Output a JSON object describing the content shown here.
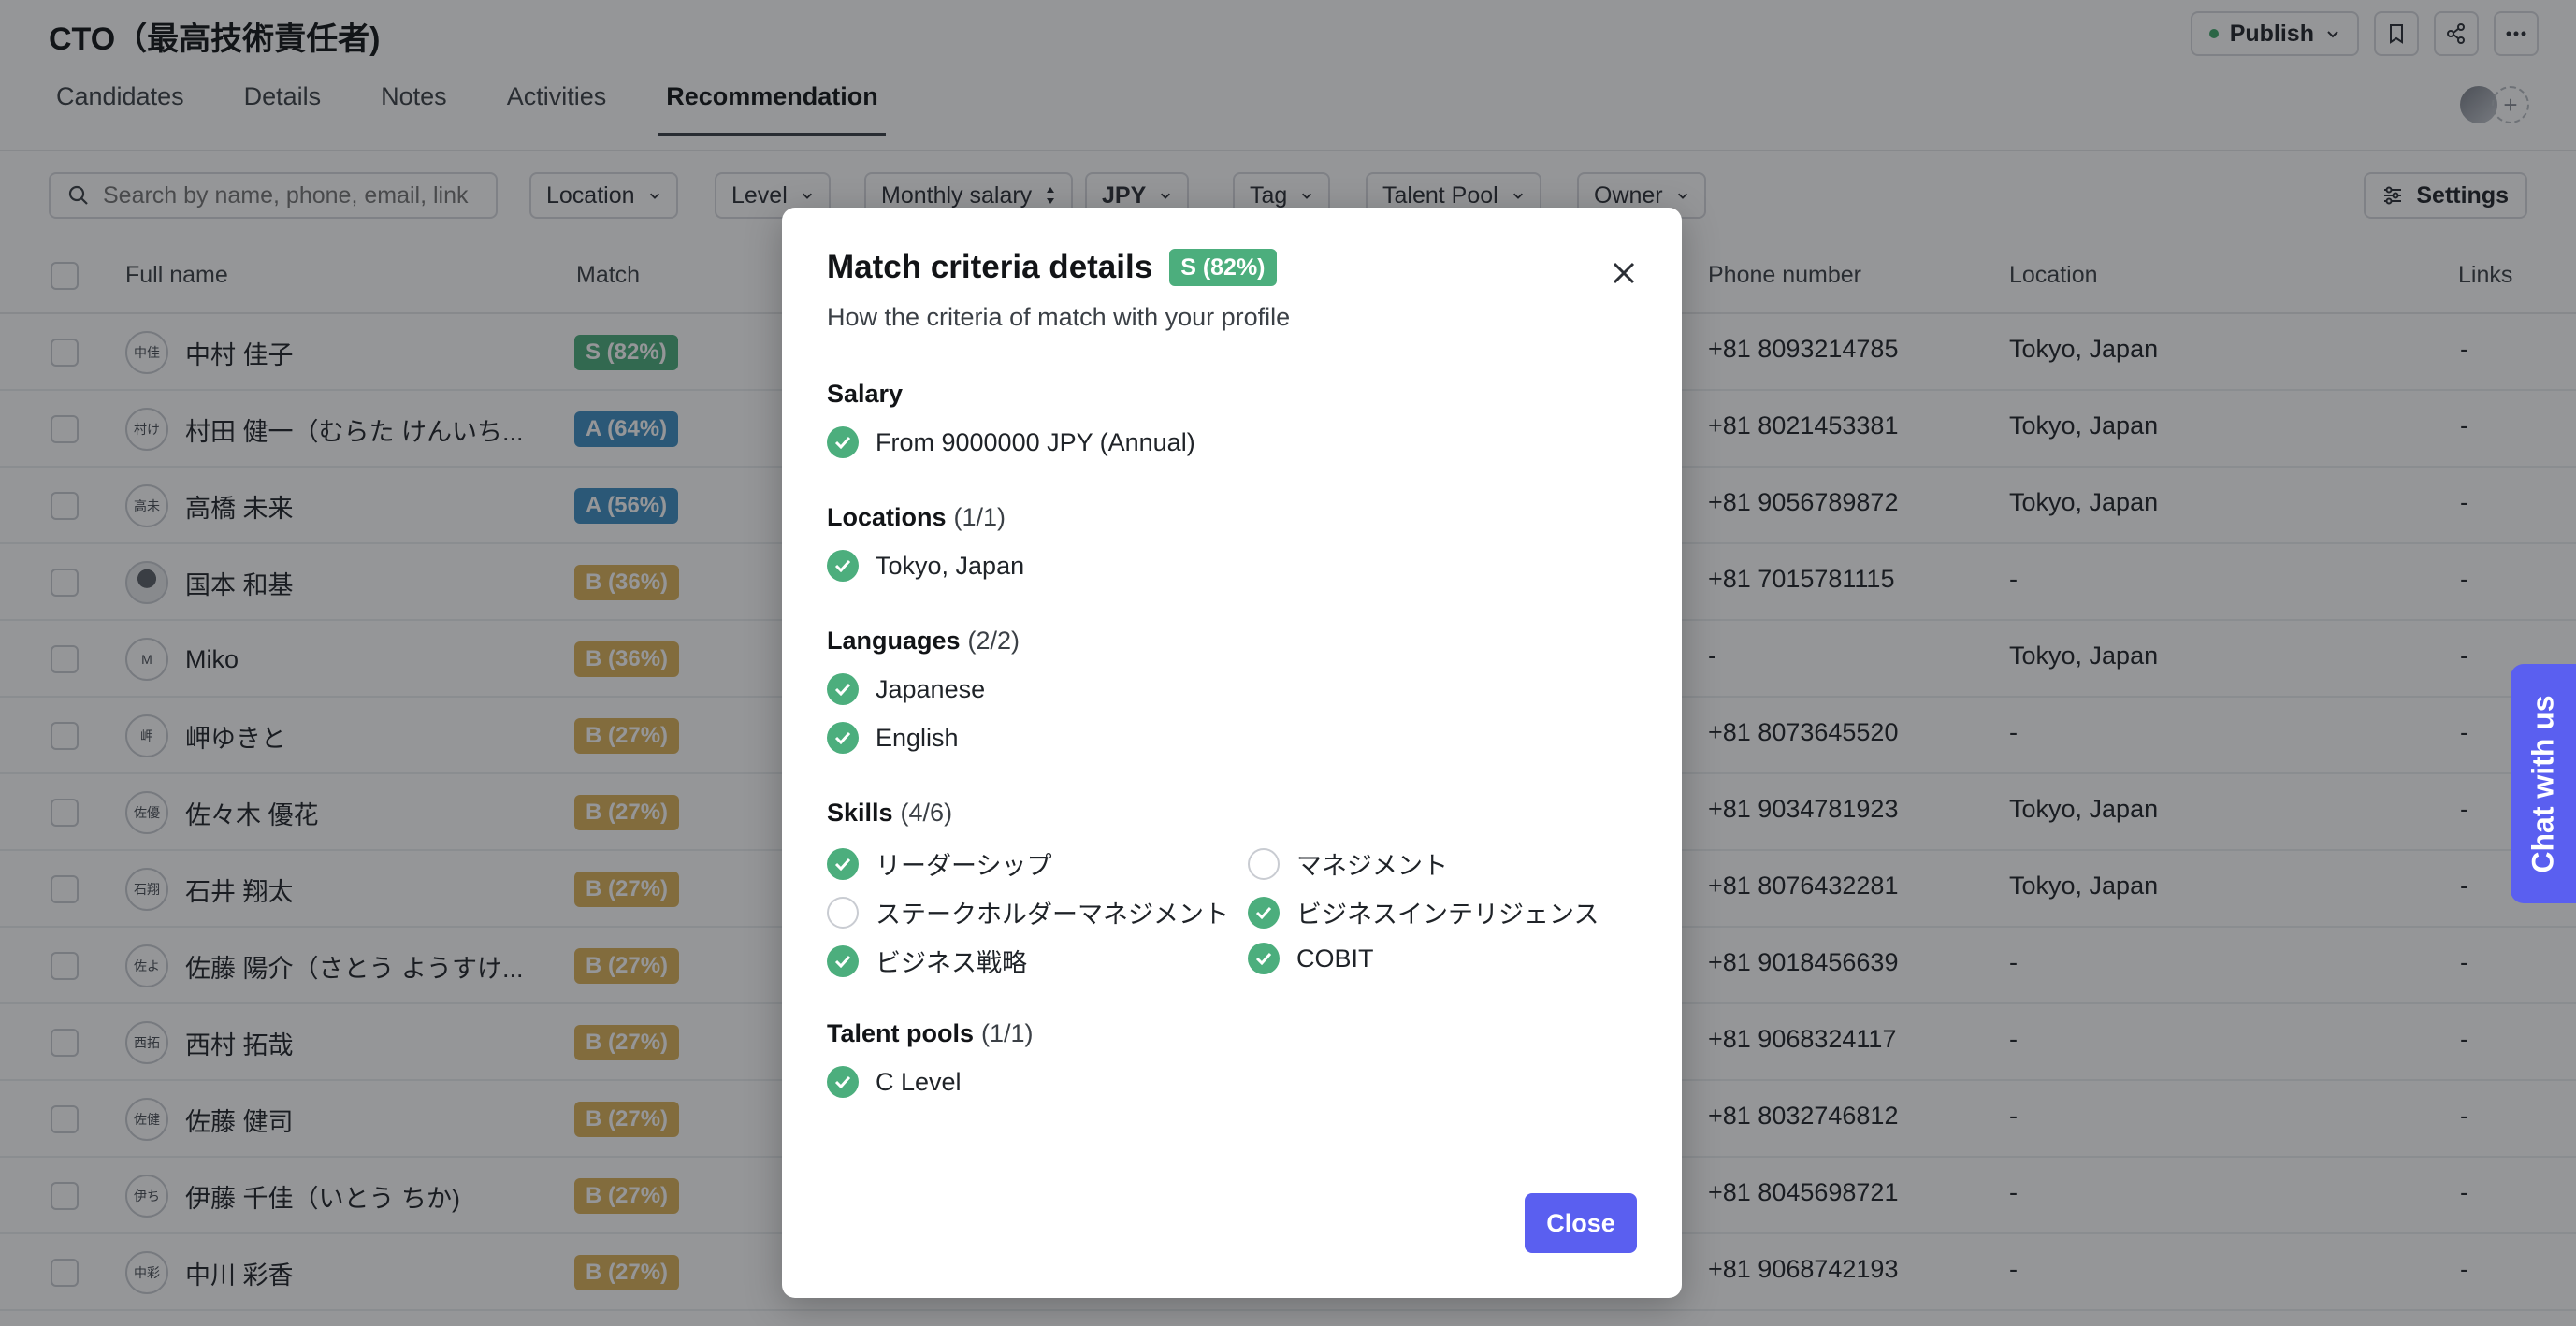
{
  "header": {
    "title": "CTO（最高技術責任者)",
    "publish_label": "Publish",
    "tabs": [
      "Candidates",
      "Details",
      "Notes",
      "Activities",
      "Recommendation"
    ],
    "active_tab": "Recommendation"
  },
  "filters": {
    "search_placeholder": "Search by name, phone, email, link",
    "location": "Location",
    "level": "Level",
    "monthly_salary": "Monthly salary",
    "currency": "JPY",
    "tag": "Tag",
    "talent_pool": "Talent Pool",
    "owner": "Owner",
    "settings": "Settings"
  },
  "table": {
    "columns": {
      "full_name": "Full name",
      "match": "Match",
      "phone": "Phone number",
      "location": "Location",
      "links": "Links"
    },
    "rows": [
      {
        "initials": "中佳",
        "name": "中村 佳子",
        "match": "S (82%)",
        "phone": "+81 8093214785",
        "location": "Tokyo, Japan",
        "links": "-"
      },
      {
        "initials": "村け",
        "name": "村田 健一（むらた けんいち...",
        "match": "A (64%)",
        "phone": "+81 8021453381",
        "location": "Tokyo, Japan",
        "links": "-"
      },
      {
        "initials": "高未",
        "name": "高橋 未来",
        "match": "A (56%)",
        "phone": "+81 9056789872",
        "location": "Tokyo, Japan",
        "links": "-"
      },
      {
        "initials": "",
        "name": "国本 和基",
        "match": "B (36%)",
        "phone": "+81 7015781115",
        "location": "-",
        "links": "-"
      },
      {
        "initials": "M",
        "name": "Miko",
        "match": "B (36%)",
        "phone": "-",
        "location": "Tokyo, Japan",
        "links": "-"
      },
      {
        "initials": "岬",
        "name": "岬ゆきと",
        "match": "B (27%)",
        "phone": "+81 8073645520",
        "location": "-",
        "links": "-"
      },
      {
        "initials": "佐優",
        "name": "佐々木 優花",
        "match": "B (27%)",
        "phone": "+81 9034781923",
        "location": "Tokyo, Japan",
        "links": "-"
      },
      {
        "initials": "石翔",
        "name": "石井 翔太",
        "match": "B (27%)",
        "phone": "+81 8076432281",
        "location": "Tokyo, Japan",
        "links": "-"
      },
      {
        "initials": "佐よ",
        "name": "佐藤 陽介（さとう ようすけ...",
        "match": "B (27%)",
        "phone": "+81 9018456639",
        "location": "-",
        "links": "-"
      },
      {
        "initials": "西拓",
        "name": "西村 拓哉",
        "match": "B (27%)",
        "phone": "+81 9068324117",
        "location": "-",
        "links": "-"
      },
      {
        "initials": "佐健",
        "name": "佐藤 健司",
        "match": "B (27%)",
        "phone": "+81 8032746812",
        "location": "-",
        "links": "-"
      },
      {
        "initials": "伊ち",
        "name": "伊藤 千佳（いとう ちか)",
        "match": "B (27%)",
        "phone": "+81 8045698721",
        "location": "-",
        "links": "-"
      },
      {
        "initials": "中彩",
        "name": "中川 彩香",
        "match": "B (27%)",
        "phone": "+81 9068742193",
        "location": "-",
        "links": "-"
      }
    ]
  },
  "modal": {
    "title": "Match criteria details",
    "badge": "S (82%)",
    "subtitle": "How the criteria of match with your profile",
    "salary": {
      "title": "Salary",
      "item": "From 9000000 JPY (Annual)"
    },
    "locations": {
      "title": "Locations",
      "count": "(1/1)",
      "items": [
        "Tokyo, Japan"
      ]
    },
    "languages": {
      "title": "Languages",
      "count": "(2/2)",
      "items": [
        "Japanese",
        "English"
      ]
    },
    "skills": {
      "title": "Skills",
      "count": "(4/6)",
      "items": [
        {
          "label": "リーダーシップ",
          "matched": true
        },
        {
          "label": "マネジメント",
          "matched": false
        },
        {
          "label": "ステークホルダーマネジメント",
          "matched": false
        },
        {
          "label": "ビジネスインテリジェンス",
          "matched": true
        },
        {
          "label": "ビジネス戦略",
          "matched": true
        },
        {
          "label": "COBIT",
          "matched": true
        }
      ]
    },
    "talent_pools": {
      "title": "Talent pools",
      "count": "(1/1)",
      "items": [
        "C Level"
      ]
    },
    "close_label": "Close"
  },
  "chat": {
    "label": "Chat with us"
  },
  "colors": {
    "accent": "#5a5ff0",
    "match_s": "#4cae7d",
    "match_a": "#3e8ec4",
    "match_b": "#ddb25a"
  }
}
